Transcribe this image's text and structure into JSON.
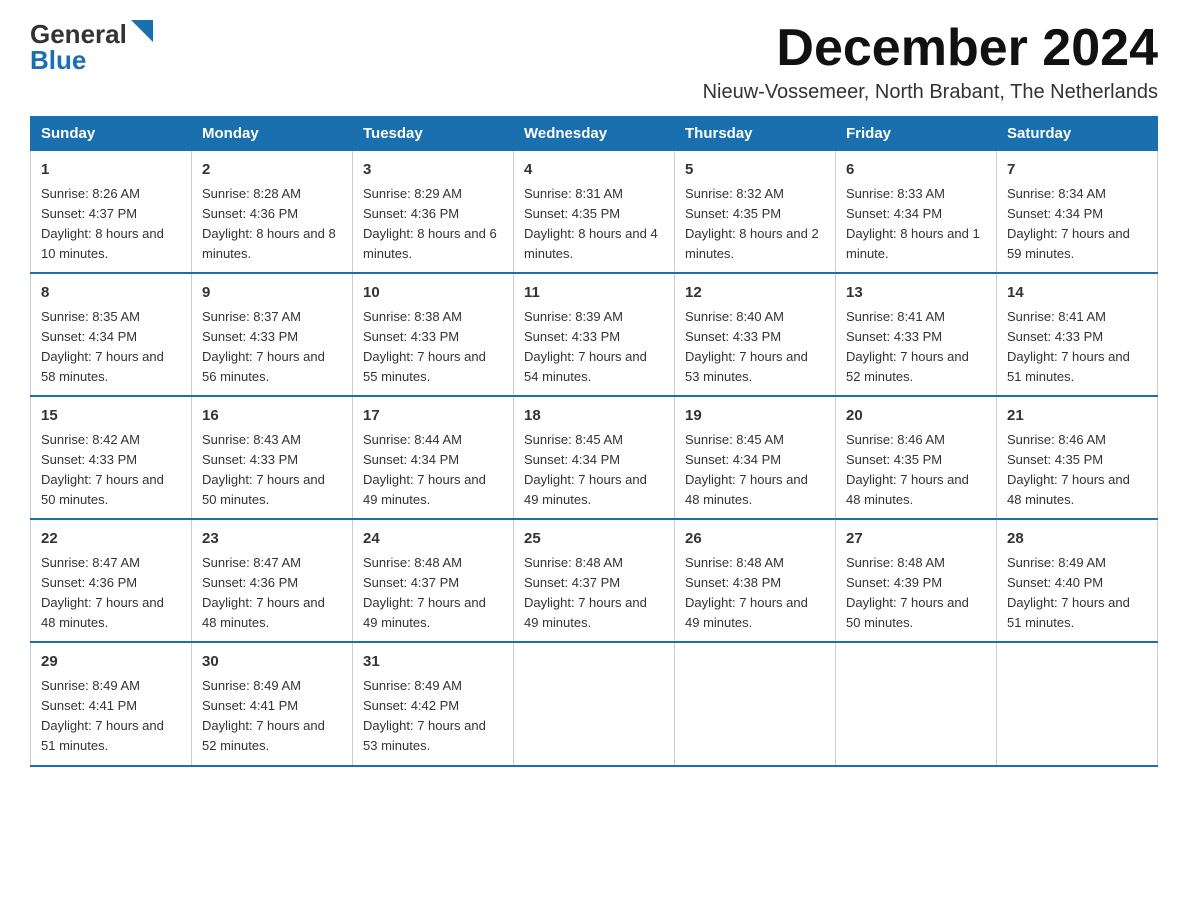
{
  "logo": {
    "general": "General",
    "blue": "Blue"
  },
  "header": {
    "month_title": "December 2024",
    "subtitle": "Nieuw-Vossemeer, North Brabant, The Netherlands"
  },
  "days_of_week": [
    "Sunday",
    "Monday",
    "Tuesday",
    "Wednesday",
    "Thursday",
    "Friday",
    "Saturday"
  ],
  "weeks": [
    [
      {
        "day": "1",
        "sunrise": "8:26 AM",
        "sunset": "4:37 PM",
        "daylight": "8 hours and 10 minutes."
      },
      {
        "day": "2",
        "sunrise": "8:28 AM",
        "sunset": "4:36 PM",
        "daylight": "8 hours and 8 minutes."
      },
      {
        "day": "3",
        "sunrise": "8:29 AM",
        "sunset": "4:36 PM",
        "daylight": "8 hours and 6 minutes."
      },
      {
        "day": "4",
        "sunrise": "8:31 AM",
        "sunset": "4:35 PM",
        "daylight": "8 hours and 4 minutes."
      },
      {
        "day": "5",
        "sunrise": "8:32 AM",
        "sunset": "4:35 PM",
        "daylight": "8 hours and 2 minutes."
      },
      {
        "day": "6",
        "sunrise": "8:33 AM",
        "sunset": "4:34 PM",
        "daylight": "8 hours and 1 minute."
      },
      {
        "day": "7",
        "sunrise": "8:34 AM",
        "sunset": "4:34 PM",
        "daylight": "7 hours and 59 minutes."
      }
    ],
    [
      {
        "day": "8",
        "sunrise": "8:35 AM",
        "sunset": "4:34 PM",
        "daylight": "7 hours and 58 minutes."
      },
      {
        "day": "9",
        "sunrise": "8:37 AM",
        "sunset": "4:33 PM",
        "daylight": "7 hours and 56 minutes."
      },
      {
        "day": "10",
        "sunrise": "8:38 AM",
        "sunset": "4:33 PM",
        "daylight": "7 hours and 55 minutes."
      },
      {
        "day": "11",
        "sunrise": "8:39 AM",
        "sunset": "4:33 PM",
        "daylight": "7 hours and 54 minutes."
      },
      {
        "day": "12",
        "sunrise": "8:40 AM",
        "sunset": "4:33 PM",
        "daylight": "7 hours and 53 minutes."
      },
      {
        "day": "13",
        "sunrise": "8:41 AM",
        "sunset": "4:33 PM",
        "daylight": "7 hours and 52 minutes."
      },
      {
        "day": "14",
        "sunrise": "8:41 AM",
        "sunset": "4:33 PM",
        "daylight": "7 hours and 51 minutes."
      }
    ],
    [
      {
        "day": "15",
        "sunrise": "8:42 AM",
        "sunset": "4:33 PM",
        "daylight": "7 hours and 50 minutes."
      },
      {
        "day": "16",
        "sunrise": "8:43 AM",
        "sunset": "4:33 PM",
        "daylight": "7 hours and 50 minutes."
      },
      {
        "day": "17",
        "sunrise": "8:44 AM",
        "sunset": "4:34 PM",
        "daylight": "7 hours and 49 minutes."
      },
      {
        "day": "18",
        "sunrise": "8:45 AM",
        "sunset": "4:34 PM",
        "daylight": "7 hours and 49 minutes."
      },
      {
        "day": "19",
        "sunrise": "8:45 AM",
        "sunset": "4:34 PM",
        "daylight": "7 hours and 48 minutes."
      },
      {
        "day": "20",
        "sunrise": "8:46 AM",
        "sunset": "4:35 PM",
        "daylight": "7 hours and 48 minutes."
      },
      {
        "day": "21",
        "sunrise": "8:46 AM",
        "sunset": "4:35 PM",
        "daylight": "7 hours and 48 minutes."
      }
    ],
    [
      {
        "day": "22",
        "sunrise": "8:47 AM",
        "sunset": "4:36 PM",
        "daylight": "7 hours and 48 minutes."
      },
      {
        "day": "23",
        "sunrise": "8:47 AM",
        "sunset": "4:36 PM",
        "daylight": "7 hours and 48 minutes."
      },
      {
        "day": "24",
        "sunrise": "8:48 AM",
        "sunset": "4:37 PM",
        "daylight": "7 hours and 49 minutes."
      },
      {
        "day": "25",
        "sunrise": "8:48 AM",
        "sunset": "4:37 PM",
        "daylight": "7 hours and 49 minutes."
      },
      {
        "day": "26",
        "sunrise": "8:48 AM",
        "sunset": "4:38 PM",
        "daylight": "7 hours and 49 minutes."
      },
      {
        "day": "27",
        "sunrise": "8:48 AM",
        "sunset": "4:39 PM",
        "daylight": "7 hours and 50 minutes."
      },
      {
        "day": "28",
        "sunrise": "8:49 AM",
        "sunset": "4:40 PM",
        "daylight": "7 hours and 51 minutes."
      }
    ],
    [
      {
        "day": "29",
        "sunrise": "8:49 AM",
        "sunset": "4:41 PM",
        "daylight": "7 hours and 51 minutes."
      },
      {
        "day": "30",
        "sunrise": "8:49 AM",
        "sunset": "4:41 PM",
        "daylight": "7 hours and 52 minutes."
      },
      {
        "day": "31",
        "sunrise": "8:49 AM",
        "sunset": "4:42 PM",
        "daylight": "7 hours and 53 minutes."
      },
      null,
      null,
      null,
      null
    ]
  ]
}
